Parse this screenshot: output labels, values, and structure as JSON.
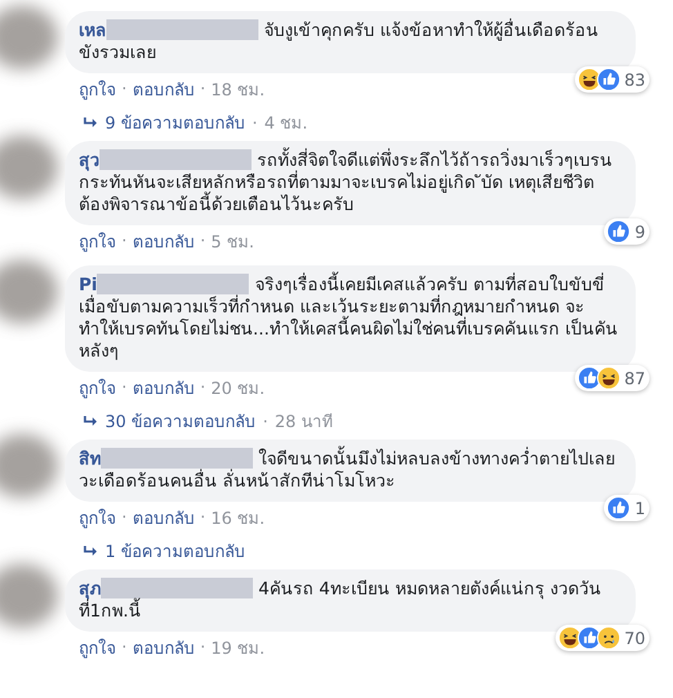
{
  "separator": "·",
  "comments": [
    {
      "author": "เหล",
      "text": "จับงูเข้าคุกครับ แจ้งข้อหาทำให้ผู้อื่นเดือดร้อน ขังรวมเลย",
      "reactions": [
        {
          "kind": "haha"
        },
        {
          "kind": "like"
        }
      ],
      "reaction_count": "83",
      "actions": [
        "ถูกใจ",
        "ตอบกลับ"
      ],
      "time": "18 ชม.",
      "replies": {
        "label": "9 ข้อความตอบกลับ",
        "time": "4 ชม."
      }
    },
    {
      "author": "สุว",
      "text": "รถทั้งสี่จิตใจดีแต่พึ่งระลึกไว้ถ้ารถวิ่งมาเร็วๆเบรนกระทันหันจะเสียหลักหรือรถที่ตามมาจะเบรคไม่อยู่เกิด ับัด เหตุเสียชีวิตต้องพิจารณาข้อนี้ด้วยเตือนไว้นะครับ",
      "reactions": [
        {
          "kind": "like"
        }
      ],
      "reaction_count": "9",
      "actions": [
        "ถูกใจ",
        "ตอบกลับ"
      ],
      "time": "5 ชม."
    },
    {
      "author": "Pi",
      "text": "จริงๆเรื่องนี้เคยมีเคสแล้วครับ ตามที่สอบใบขับขี่ เมื่อขับตามความเร็วที่กำหนด และเว้นระยะตามที่กฎหมายกำหนด จะทำให้เบรคทันโดยไม่ชน...ทำให้เคสนี้คนผิดไม่ใช่คนที่เบรคคันแรก เป็นคันหลังๆ",
      "reactions": [
        {
          "kind": "like"
        },
        {
          "kind": "haha"
        }
      ],
      "reaction_count": "87",
      "actions": [
        "ถูกใจ",
        "ตอบกลับ"
      ],
      "time": "20 ชม.",
      "replies": {
        "label": "30 ข้อความตอบกลับ",
        "time": "28 นาที"
      }
    },
    {
      "author": "สิท",
      "text": "ใจดีขนาดนั้นมึงไม่หลบลงข้างทางคว่ำตายไปเลยวะเดือดร้อนคนอื่น ลั่นหน้าสักทีน่าโมโหวะ",
      "reactions": [
        {
          "kind": "like"
        }
      ],
      "reaction_count": "1",
      "actions": [
        "ถูกใจ",
        "ตอบกลับ"
      ],
      "time": "16 ชม.",
      "replies": {
        "label": "1 ข้อความตอบกลับ"
      }
    },
    {
      "author": "สุภ",
      "text": "4คันรถ 4ทะเบียน หมดหลายตังค์แน่กรุ งวดวันที่1กพ.นี้",
      "reactions": [
        {
          "kind": "haha"
        },
        {
          "kind": "like"
        },
        {
          "kind": "sad"
        }
      ],
      "reaction_count": "70",
      "actions": [
        "ถูกใจ",
        "ตอบกลับ"
      ],
      "time": "19 ชม."
    }
  ]
}
